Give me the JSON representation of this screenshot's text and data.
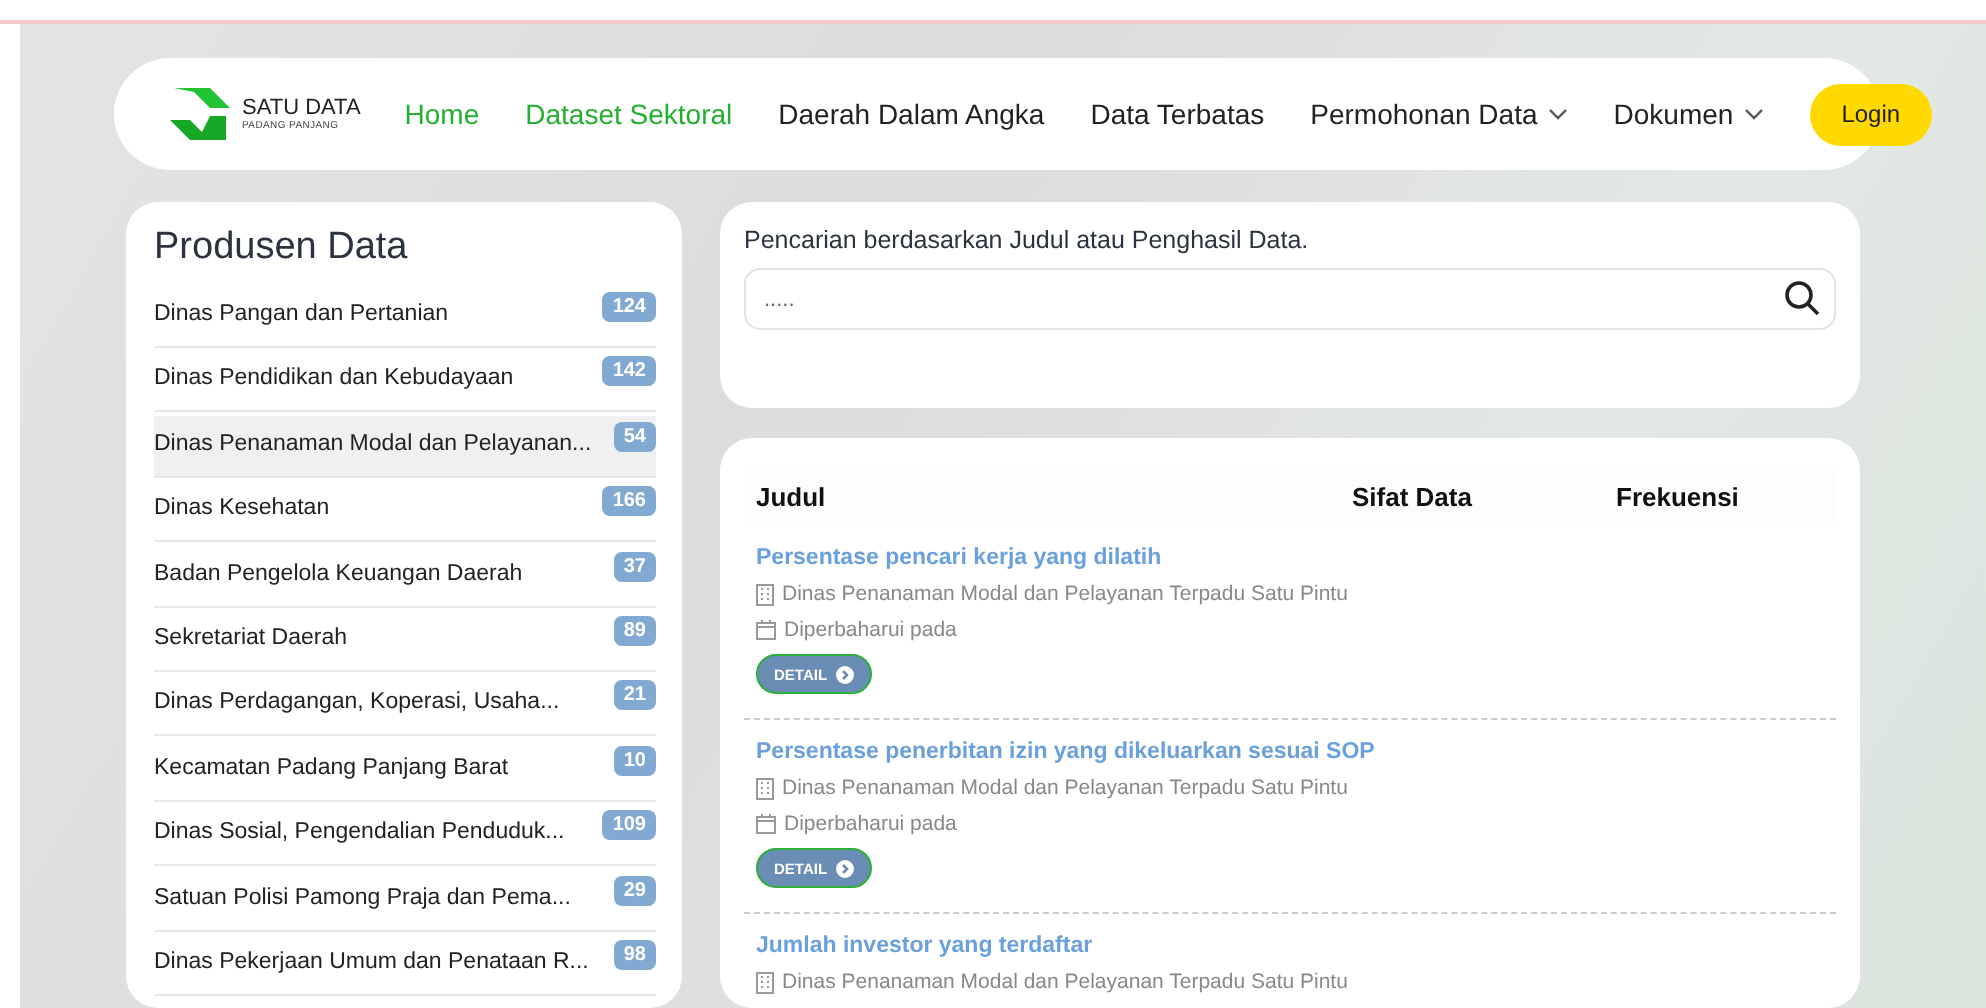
{
  "navbar": {
    "logo": {
      "title": "SATU DATA",
      "subtitle": "PADANG PANJANG"
    },
    "links": [
      {
        "label": "Home",
        "selected": true,
        "dropdown": false
      },
      {
        "label": "Dataset Sektoral",
        "selected": true,
        "dropdown": false
      },
      {
        "label": "Daerah Dalam Angka",
        "selected": false,
        "dropdown": false
      },
      {
        "label": "Data Terbatas",
        "selected": false,
        "dropdown": false
      },
      {
        "label": "Permohonan Data",
        "selected": false,
        "dropdown": true
      },
      {
        "label": "Dokumen",
        "selected": false,
        "dropdown": true
      }
    ],
    "login_button": "Login"
  },
  "sidebar": {
    "title": "Produsen Data",
    "items": [
      {
        "name": "Dinas Pangan dan Pertanian",
        "count": "124",
        "selected": false
      },
      {
        "name": "Dinas Pendidikan dan Kebudayaan",
        "count": "142",
        "selected": false
      },
      {
        "name": "Dinas Penanaman Modal dan Pelayanan...",
        "count": "54",
        "selected": true
      },
      {
        "name": "Dinas Kesehatan",
        "count": "166",
        "selected": false
      },
      {
        "name": "Badan Pengelola Keuangan Daerah",
        "count": "37",
        "selected": false
      },
      {
        "name": "Sekretariat Daerah",
        "count": "89",
        "selected": false
      },
      {
        "name": "Dinas Perdagangan, Koperasi, Usaha...",
        "count": "21",
        "selected": false
      },
      {
        "name": "Kecamatan Padang Panjang Barat",
        "count": "10",
        "selected": false
      },
      {
        "name": "Dinas Sosial, Pengendalian Penduduk...",
        "count": "109",
        "selected": false
      },
      {
        "name": "Satuan Polisi Pamong Praja dan Pema...",
        "count": "29",
        "selected": false
      },
      {
        "name": "Dinas Pekerjaan Umum dan Penataan R...",
        "count": "98",
        "selected": false
      }
    ]
  },
  "search": {
    "label": "Pencarian berdasarkan Judul atau Penghasil Data.",
    "placeholder": "....."
  },
  "table": {
    "columns": [
      "Judul",
      "Sifat Data",
      "Frekuensi"
    ],
    "rows": [
      {
        "title": "Persentase pencari kerja yang dilatih",
        "agency": "Dinas Penanaman Modal dan Pelayanan Terpadu Satu Pintu",
        "updated": "Diperbaharui pada",
        "button": "DETAIL"
      },
      {
        "title": "Persentase penerbitan izin yang dikeluarkan sesuai SOP",
        "agency": "Dinas Penanaman Modal dan Pelayanan Terpadu Satu Pintu",
        "updated": "Diperbaharui pada",
        "button": "DETAIL"
      },
      {
        "title": "Jumlah investor yang terdaftar",
        "agency": "Dinas Penanaman Modal dan Pelayanan Terpadu Satu Pintu"
      }
    ]
  }
}
